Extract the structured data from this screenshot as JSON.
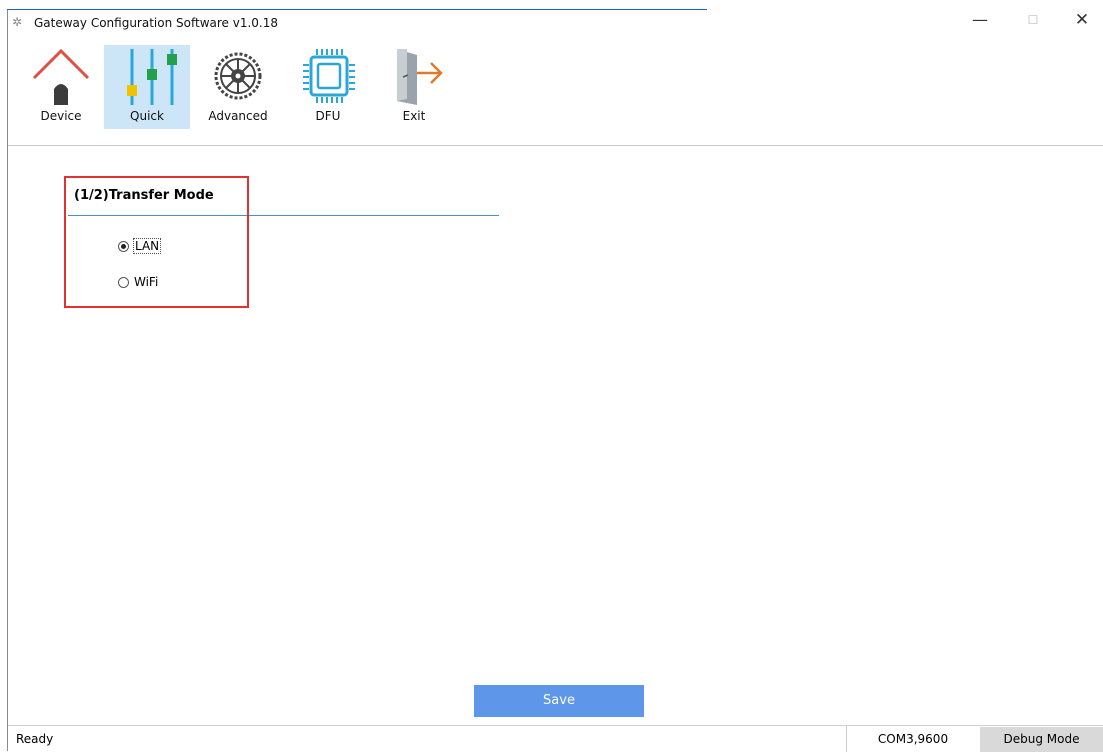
{
  "window": {
    "title": "Gateway Configuration Software v1.0.18",
    "minimize": "—",
    "maximize": "☐",
    "close": "✕"
  },
  "toolbar": {
    "items": [
      {
        "label": "Device",
        "icon": "house-icon",
        "active": false
      },
      {
        "label": "Quick",
        "icon": "sliders-icon",
        "active": true
      },
      {
        "label": "Advanced",
        "icon": "gear-icon",
        "active": false
      },
      {
        "label": "DFU",
        "icon": "chip-icon",
        "active": false
      },
      {
        "label": "Exit",
        "icon": "exit-door-icon",
        "active": false
      }
    ]
  },
  "section": {
    "title": "(1/2)Transfer Mode",
    "options": [
      {
        "label": "LAN",
        "checked": true
      },
      {
        "label": "WiFi",
        "checked": false
      }
    ]
  },
  "actions": {
    "save_label": "Save"
  },
  "statusbar": {
    "status": "Ready",
    "port": "COM3,9600",
    "mode_button": "Debug Mode"
  },
  "colors": {
    "active_tab": "#cde6f7",
    "save_button": "#5e97ea",
    "highlight": "#e03232",
    "accent_line": "#4a90c8"
  }
}
